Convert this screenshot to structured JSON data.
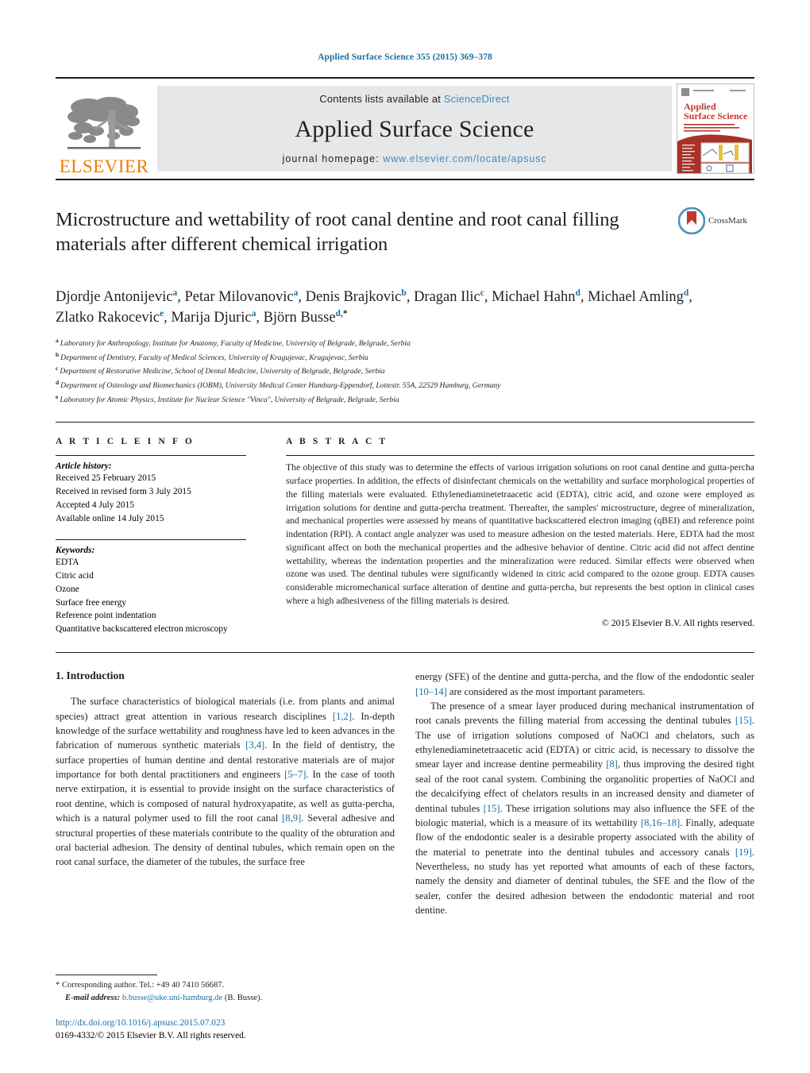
{
  "running_head": "Applied Surface Science 355 (2015) 369–378",
  "masthead": {
    "publisher_name": "ELSEVIER",
    "contents_prefix": "Contents lists available at",
    "contents_link": "ScienceDirect",
    "journal_title": "Applied Surface Science",
    "homepage_prefix": "journal homepage:",
    "homepage_url": "www.elsevier.com/locate/apsusc",
    "cover_title_line1": "Applied",
    "cover_title_line2": "Surface Science"
  },
  "article": {
    "title": "Microstructure and wettability of root canal dentine and root canal filling materials after different chemical irrigation",
    "crossmark_label": "CrossMark",
    "authors": [
      {
        "name": "Djordje Antonijevic",
        "sup": "a",
        "sep": ", "
      },
      {
        "name": "Petar Milovanovic",
        "sup": "a",
        "sep": ", "
      },
      {
        "name": "Denis Brajkovic",
        "sup": "b",
        "sep": ", "
      },
      {
        "name": "Dragan Ilic",
        "sup": "c",
        "sep": ", "
      },
      {
        "name": "Michael Hahn",
        "sup": "d",
        "sep": ", "
      },
      {
        "name": "Michael Amling",
        "sup": "d",
        "sep": ", "
      },
      {
        "name": "Zlatko Rakocevic",
        "sup": "e",
        "sep": ", "
      },
      {
        "name": "Marija Djuric",
        "sup": "a",
        "sep": ", "
      },
      {
        "name": "Björn Busse",
        "sup": "d,",
        "sup_star": "*",
        "sep": ""
      }
    ],
    "affiliations": [
      {
        "mark": "a",
        "text": "Laboratory for Anthropology, Institute for Anatomy, Faculty of Medicine, University of Belgrade, Belgrade, Serbia"
      },
      {
        "mark": "b",
        "text": "Department of Dentistry, Faculty of Medical Sciences, University of Kragujevac, Kragujevac, Serbia"
      },
      {
        "mark": "c",
        "text": "Department of Restorative Medicine, School of Dental Medicine, University of Belgrade, Belgrade, Serbia"
      },
      {
        "mark": "d",
        "text": "Department of Osteology and Biomechanics (IOBM), University Medical Center Hamburg-Eppendorf, Lottestr. 55A, 22529 Hamburg, Germany"
      },
      {
        "mark": "e",
        "text": "Laboratory for Atomic Physics, Institute for Nuclear Science \"Vinca\", University of Belgrade, Belgrade, Serbia"
      }
    ]
  },
  "article_info": {
    "heading": "A R T I C L E    I N F O",
    "history_label": "Article history:",
    "history": [
      "Received 25 February 2015",
      "Received in revised form 3 July 2015",
      "Accepted 4 July 2015",
      "Available online 14 July 2015"
    ],
    "keywords_label": "Keywords:",
    "keywords": [
      "EDTA",
      "Citric acid",
      "Ozone",
      "Surface free energy",
      "Reference point indentation",
      "Quantitative backscattered electron microscopy"
    ]
  },
  "abstract": {
    "heading": "A B S T R A C T",
    "text": "The objective of this study was to determine the effects of various irrigation solutions on root canal dentine and gutta-percha surface properties. In addition, the effects of disinfectant chemicals on the wettability and surface morphological properties of the filling materials were evaluated. Ethylenediaminetetraacetic acid (EDTA), citric acid, and ozone were employed as irrigation solutions for dentine and gutta-percha treatment. Thereafter, the samples' microstructure, degree of mineralization, and mechanical properties were assessed by means of quantitative backscattered electron imaging (qBEI) and reference point indentation (RPI). A contact angle analyzer was used to measure adhesion on the tested materials. Here, EDTA had the most significant affect on both the mechanical properties and the adhesive behavior of dentine. Citric acid did not affect dentine wettability, whereas the indentation properties and the mineralization were reduced. Similar effects were observed when ozone was used. The dentinal tubules were significantly widened in citric acid compared to the ozone group. EDTA causes considerable micromechanical surface alteration of dentine and gutta-percha, but represents the best option in clinical cases where a high adhesiveness of the filling materials is desired.",
    "copyright": "© 2015 Elsevier B.V. All rights reserved."
  },
  "body": {
    "section_title": "1.  Introduction",
    "left_paragraph": "The surface characteristics of biological materials (i.e. from plants and animal species) attract great attention in various research disciplines [1,2]. In-depth knowledge of the surface wettability and roughness have led to keen advances in the fabrication of numerous synthetic materials [3,4]. In the field of dentistry, the surface properties of human dentine and dental restorative materials are of major importance for both dental practitioners and engineers [5–7]. In the case of tooth nerve extirpation, it is essential to provide insight on the surface characteristics of root dentine, which is composed of natural hydroxyapatite, as well as gutta-percha, which is a natural polymer used to fill the root canal [8,9]. Several adhesive and structural properties of these materials contribute to the quality of the obturation and oral bacterial adhesion. The density of dentinal tubules, which remain open on the root canal surface, the diameter of the tubules, the surface free",
    "right_paragraph_1": "energy (SFE) of the dentine and gutta-percha, and the flow of the endodontic sealer [10–14] are considered as the most important parameters.",
    "right_paragraph_2": "The presence of a smear layer produced during mechanical instrumentation of root canals prevents the filling material from accessing the dentinal tubules [15]. The use of irrigation solutions composed of NaOCl and chelators, such as ethylenediaminetetraacetic acid (EDTA) or citric acid, is necessary to dissolve the smear layer and increase dentine permeability [8], thus improving the desired tight seal of the root canal system. Combining the organolitic properties of NaOCl and the decalcifying effect of chelators results in an increased density and diameter of dentinal tubules [15]. These irrigation solutions may also influence the SFE of the biologic material, which is a measure of its wettability [8,16–18]. Finally, adequate flow of the endodontic sealer is a desirable property associated with the ability of the material to penetrate into the dentinal tubules and accessory canals [19]. Nevertheless, no study has yet reported what amounts of each of these factors, namely the density and diameter of dentinal tubules, the SFE and the flow of the sealer, confer the desired adhesion between the endodontic material and root dentine."
  },
  "footer": {
    "corresponding": "*  Corresponding author. Tel.: +49 40 7410 56687.",
    "email_label": "E-mail address:",
    "email": "b.busse@uke.uni-hamburg.de",
    "email_suffix": "(B. Busse).",
    "doi": "http://dx.doi.org/10.1016/j.apsusc.2015.07.023",
    "issn_line": "0169-4332/© 2015 Elsevier B.V. All rights reserved."
  },
  "colors": {
    "link": "#1a6fa3",
    "elsevier_orange": "#ef7d00",
    "band_gray": "#e6e7e8",
    "crossmark_red": "#c0392b",
    "crossmark_blue": "#4a90b8"
  }
}
